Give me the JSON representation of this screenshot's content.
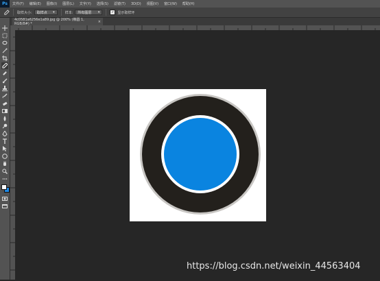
{
  "app": {
    "logo": "Ps"
  },
  "menubar": {
    "items": [
      "文件(F)",
      "编辑(E)",
      "图像(I)",
      "图层(L)",
      "文字(Y)",
      "选择(S)",
      "滤镜(T)",
      "3D(D)",
      "视图(V)",
      "窗口(W)",
      "帮助(H)"
    ]
  },
  "options": {
    "tool_icon": "eyedropper-icon",
    "sample_size_label": "取样大小:",
    "sample_size_value": "取样点",
    "sample_label": "样本:",
    "sample_value": "所有图层",
    "show_ring_label": "显示取样环",
    "show_ring_checked": true
  },
  "document": {
    "tab_title": "4c0581a6256e1a89.jpg @ 200% (椭圆 1, RGB/8#) *",
    "close_glyph": "×"
  },
  "colors": {
    "ring_outer": "#c8c6c3",
    "ring_dark": "#23201c",
    "ring_inner": "#ffffff",
    "disc": "#0a84e0",
    "foreground": "#ffffff",
    "background": "#1e88e5"
  },
  "tools": [
    "move-icon",
    "marquee-icon",
    "lasso-icon",
    "magic-wand-icon",
    "crop-icon",
    "eyedropper-icon",
    "healing-brush-icon",
    "brush-icon",
    "clone-stamp-icon",
    "history-brush-icon",
    "eraser-icon",
    "gradient-icon",
    "blur-icon",
    "dodge-icon",
    "pen-icon",
    "type-icon",
    "path-select-icon",
    "ellipse-tool-icon",
    "hand-icon",
    "zoom-icon",
    "more-tools-icon"
  ],
  "watermark": "https://blog.csdn.net/weixin_44563404"
}
